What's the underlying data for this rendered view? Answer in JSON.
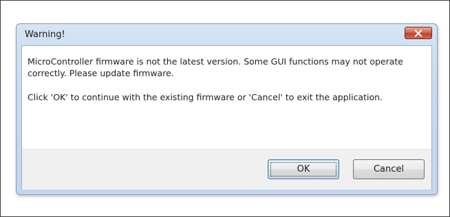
{
  "dialog": {
    "title": "Warning!",
    "close_icon": "close-x-icon",
    "message_line_1": "MicroController firmware is not the latest version.  Some GUI functions may not operate correctly.  Please update firmware.",
    "message_line_2": "Click 'OK' to continue with the existing firmware or 'Cancel' to exit the application.",
    "buttons": {
      "ok_label": "OK",
      "cancel_label": "Cancel"
    }
  },
  "colors": {
    "title_bar": "#c8dbef",
    "close_button": "#c0412b",
    "footer": "#f0f0f0",
    "default_button_border": "#3c7fb1"
  }
}
